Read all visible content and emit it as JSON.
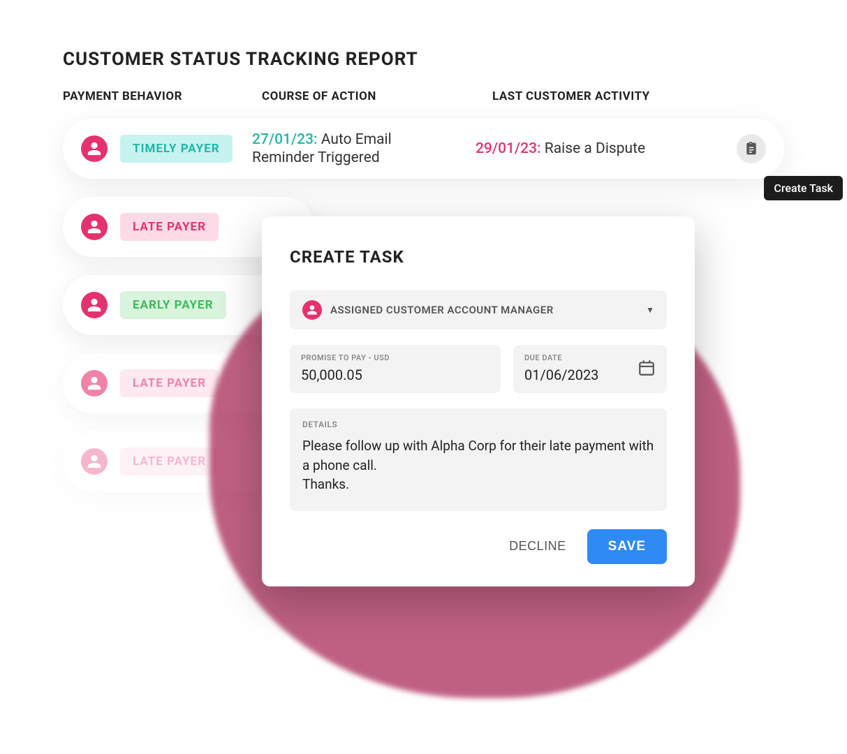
{
  "report_title": "CUSTOMER STATUS TRACKING REPORT",
  "columns": {
    "behavior": "PAYMENT BEHAVIOR",
    "action": "COURSE OF ACTION",
    "activity": "LAST CUSTOMER ACTIVITY"
  },
  "rows": [
    {
      "badge": "TIMELY PAYER",
      "badge_kind": "timely",
      "action_date": "27/01/23:",
      "action_text": " Auto Email Reminder Triggered",
      "activity_date": "29/01/23:",
      "activity_text": " Raise a Dispute"
    },
    {
      "badge": "LATE PAYER",
      "badge_kind": "late"
    },
    {
      "badge": "EARLY PAYER",
      "badge_kind": "early"
    },
    {
      "badge": "LATE PAYER",
      "badge_kind": "late"
    },
    {
      "badge": "LATE PAYER",
      "badge_kind": "late"
    }
  ],
  "tooltip": "Create Task",
  "modal": {
    "title": "CREATE TASK",
    "assignee": "ASSIGNED CUSTOMER ACCOUNT MANAGER",
    "amount_label": "PROMISE TO PAY - USD",
    "amount_value": "50,000.05",
    "due_label": "DUE DATE",
    "due_value": "01/06/2023",
    "details_label": "DETAILS",
    "details_text": "Please follow up with Alpha Corp for their late payment with a phone call.\nThanks.",
    "decline": "DECLINE",
    "save": "SAVE"
  }
}
